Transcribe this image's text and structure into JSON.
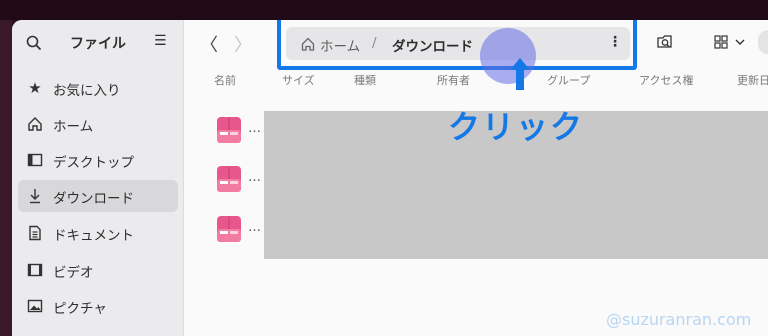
{
  "sidebar": {
    "title": "ファイル",
    "items": [
      {
        "label": "お気に入り",
        "icon": "star-icon"
      },
      {
        "label": "ホーム",
        "icon": "home-icon"
      },
      {
        "label": "デスクトップ",
        "icon": "desktop-icon"
      },
      {
        "label": "ダウンロード",
        "icon": "download-icon",
        "active": true
      },
      {
        "label": "ドキュメント",
        "icon": "document-icon"
      },
      {
        "label": "ビデオ",
        "icon": "video-icon"
      },
      {
        "label": "ピクチャ",
        "icon": "picture-icon"
      }
    ]
  },
  "pathbar": {
    "home": "ホーム",
    "separator": "/",
    "current": "ダウンロード",
    "menu_glyph": "⋮"
  },
  "nav": {
    "back_glyph": "〈",
    "forward_glyph": "〉"
  },
  "columns": [
    "名前",
    "サイズ",
    "種類",
    "所有者",
    "グループ",
    "アクセス権",
    "更新日"
  ],
  "files": [
    {
      "name": "…"
    },
    {
      "name": "…"
    },
    {
      "name": "…"
    }
  ],
  "annotation": {
    "label": "クリック",
    "color": "#1478e6"
  },
  "watermark": "@suzuranran.com",
  "colors": {
    "accent": "#1478e6",
    "file_icon": "#e8578b"
  }
}
